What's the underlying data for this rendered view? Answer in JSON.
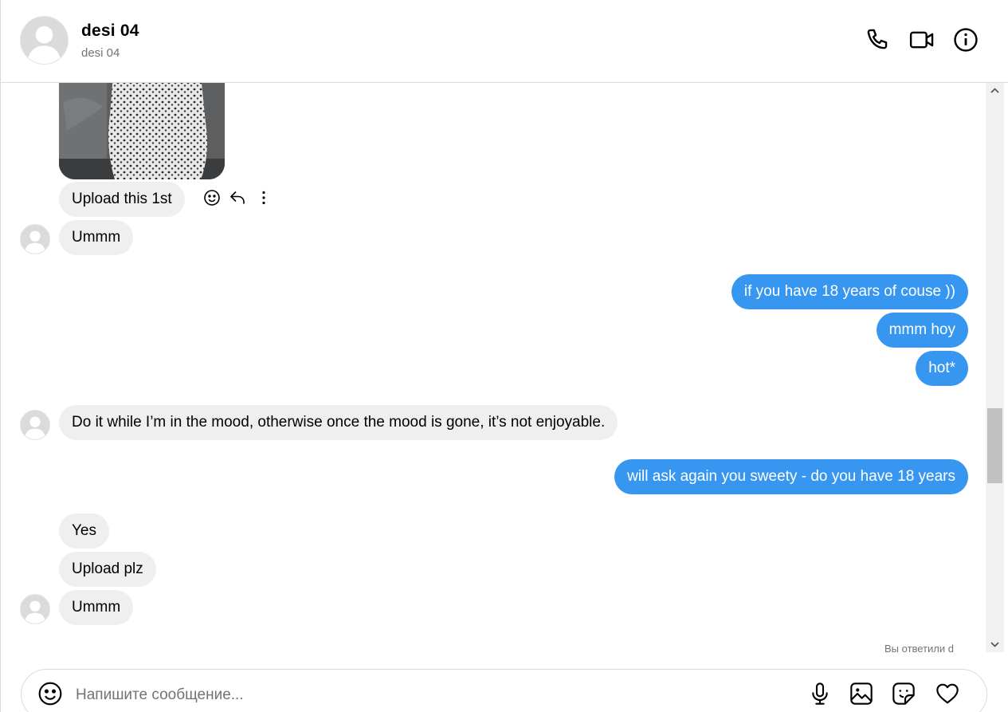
{
  "header": {
    "name": "desi       04",
    "handle": "desi      04",
    "icons": [
      "phone-icon",
      "video-camera-icon",
      "info-icon"
    ]
  },
  "conversation": {
    "messages": [
      {
        "direction": "incoming",
        "text": "Upload this 1st"
      },
      {
        "direction": "incoming",
        "text": "Ummm"
      },
      {
        "direction": "outgoing",
        "text": "if you have 18 years of couse ))"
      },
      {
        "direction": "outgoing",
        "text": "mmm hoy"
      },
      {
        "direction": "outgoing",
        "text": "hot*"
      },
      {
        "direction": "incoming",
        "text": "Do it while I’m in the mood, otherwise once the mood is gone, it’s not enjoyable."
      },
      {
        "direction": "outgoing",
        "text": "will ask again you sweety - do you have 18 years"
      },
      {
        "direction": "incoming",
        "text": "Yes"
      },
      {
        "direction": "incoming",
        "text": "Upload plz"
      },
      {
        "direction": "incoming",
        "text": "Ummm"
      }
    ],
    "message_actions": [
      "smiley-react-icon",
      "reply-arrow-icon",
      "more-dots-icon"
    ],
    "reply_note": "Вы ответили d"
  },
  "composer": {
    "placeholder": "Напишите сообщение...",
    "icons": [
      "emoji-icon",
      "microphone-icon",
      "image-icon",
      "sticker-icon",
      "heart-icon"
    ]
  },
  "colors": {
    "outgoing_bubble": "#3797f0",
    "incoming_bubble": "#efefef",
    "border": "#dbdbdb",
    "secondary_text": "#737373"
  }
}
